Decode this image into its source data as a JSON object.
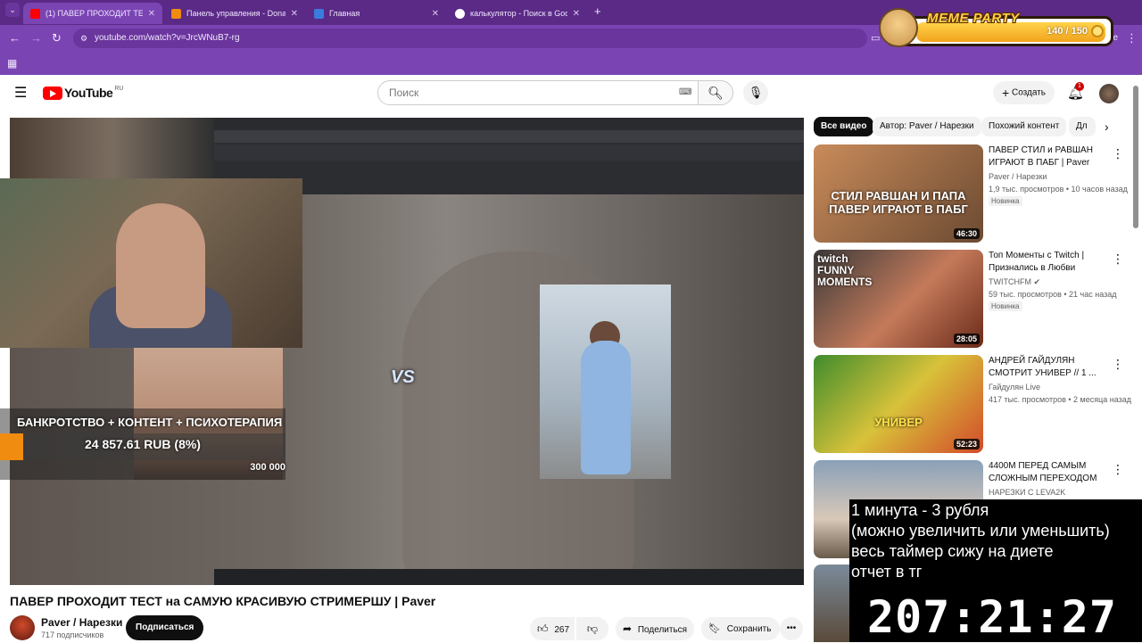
{
  "browser": {
    "tabs": [
      {
        "title": "(1) ПАВЕР ПРОХОДИТ ТЕСТ на"
      },
      {
        "title": "Панель управления - Donatio"
      },
      {
        "title": "Главная"
      },
      {
        "title": "калькулятор - Поиск в Google"
      }
    ],
    "url": "youtube.com/watch?v=JrcWNuB7-rg",
    "profile_text": "ne"
  },
  "meme_party": {
    "title": "MEME PARTY",
    "count": "140 / 150"
  },
  "header": {
    "logo_text": "YouTube",
    "region": "RU",
    "search_placeholder": "Поиск",
    "create_label": "Создать",
    "notification_count": "1"
  },
  "player": {
    "overlay": {
      "donation_title": "БАНКРОТСТВО + КОНТЕНТ + ПСИХОТЕРАПИЯ",
      "donation_amount": "24 857.61 RUB (8%)",
      "donation_goal": "300 000",
      "donation_progress": 0.08,
      "vs_text": "VS"
    }
  },
  "video": {
    "title": "ПАВЕР ПРОХОДИТ ТЕСТ на САМУЮ КРАСИВУЮ СТРИМЕРШУ | Paver",
    "channel": "Paver / Нарезки",
    "subscribers": "717 подписчиков",
    "subscribe_label": "Подписаться",
    "likes": "267",
    "share_label": "Поделиться",
    "save_label": "Сохранить"
  },
  "sidebar": {
    "chips": [
      "Все видео",
      "Автор: Paver / Нарезки",
      "Похожий контент",
      "Дл"
    ],
    "recommendations": [
      {
        "title": "ПАВЕР СТИЛ и РАВШАН ИГРАЮТ В ПАБГ | Paver",
        "channel": "Paver / Нарезки",
        "meta": "1,9 тыс. просмотров • 10 часов назад",
        "badge": "Новинка",
        "duration": "46:30",
        "thumb_text": "СТИЛ РАВШАН И ПАПА ПАВЕР ИГРАЮТ В ПАБГ"
      },
      {
        "title": "Топ Моменты с Twitch | Признались в Любви",
        "channel": "TWITCHFM",
        "meta": "59 тыс. просмотров • 21 час назад",
        "badge": "Новинка",
        "duration": "28:05",
        "thumb_text": "twitch FUNNY MOMENTS"
      },
      {
        "title": "АНДРЕЙ ГАЙДУЛЯН СМОТРИТ УНИВЕР // 1 ...",
        "channel": "Гайдулян Live",
        "meta": "417 тыс. просмотров • 2 месяца назад",
        "badge": "",
        "duration": "52:23",
        "thumb_text": "УНИВЕР"
      },
      {
        "title": "4400М ПЕРЕД САМЫМ СЛОЖНЫМ ПЕРЕХОДОМ",
        "channel": "НАРЕЗКИ С LEVA2K",
        "meta": "",
        "badge": "",
        "duration": "",
        "thumb_text": ""
      }
    ]
  },
  "timer_overlay": {
    "lines": [
      "1 минута - 3 рубля",
      "(можно увеличить или уменьшить)",
      "весь таймер сижу на диете",
      "отчет в тг"
    ],
    "time": "207:21:27"
  },
  "colors": {
    "browser_frame": "#7b44b3",
    "youtube_red": "#ff0000",
    "donation_bar": "#f08c10"
  }
}
